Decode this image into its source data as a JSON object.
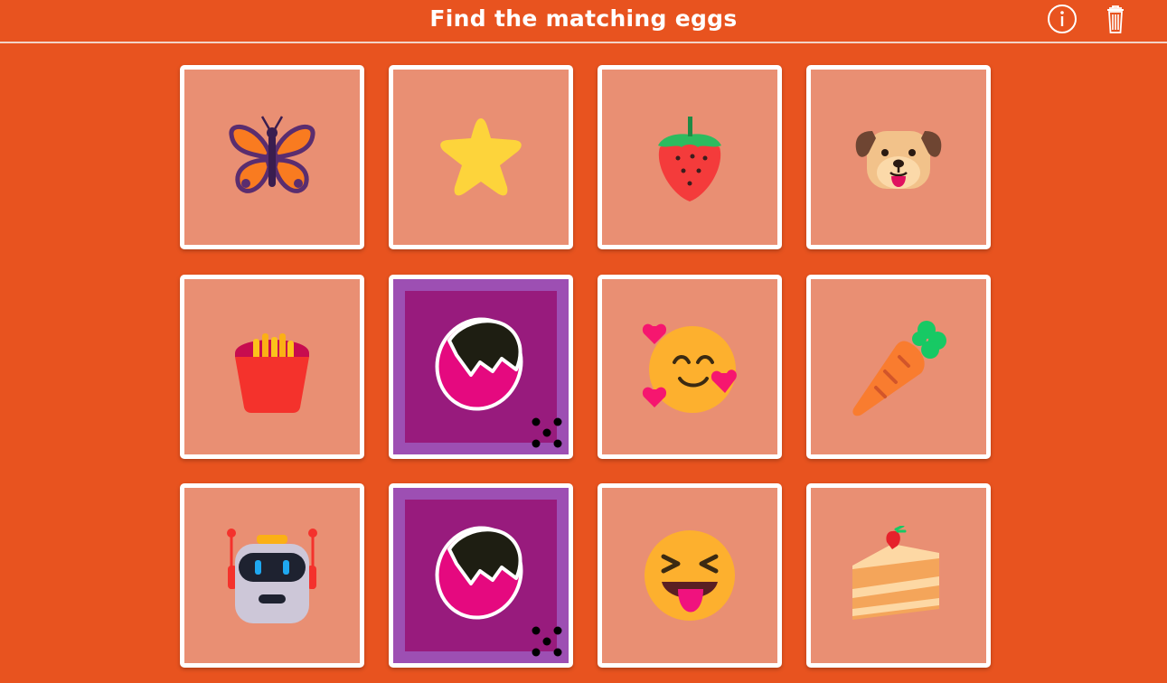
{
  "header": {
    "title": "Find the matching eggs",
    "info_icon": "info-circle-icon",
    "trash_icon": "trash-can-icon"
  },
  "colors": {
    "background": "#e8531f",
    "card_face": "#e98f73",
    "card_back_outer": "#9d4fb3",
    "card_back_inner": "#981b7d",
    "egg_pink": "#e5097f"
  },
  "cards": [
    {
      "state": "revealed",
      "icon": "butterfly-icon"
    },
    {
      "state": "revealed",
      "icon": "star-icon"
    },
    {
      "state": "revealed",
      "icon": "strawberry-icon"
    },
    {
      "state": "revealed",
      "icon": "dog-face-icon"
    },
    {
      "state": "revealed",
      "icon": "french-fries-icon"
    },
    {
      "state": "hidden",
      "icon": "cracked-egg-icon"
    },
    {
      "state": "revealed",
      "icon": "smiling-face-with-hearts-icon"
    },
    {
      "state": "revealed",
      "icon": "carrot-icon"
    },
    {
      "state": "revealed",
      "icon": "robot-icon"
    },
    {
      "state": "hidden",
      "icon": "cracked-egg-icon"
    },
    {
      "state": "revealed",
      "icon": "squinting-face-with-tongue-icon"
    },
    {
      "state": "revealed",
      "icon": "cake-slice-icon"
    }
  ]
}
